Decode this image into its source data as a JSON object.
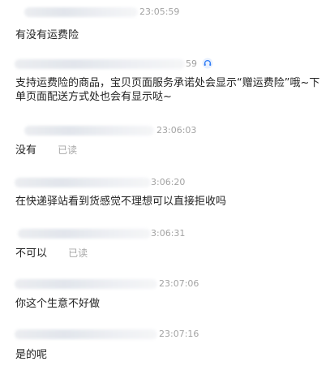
{
  "messages": [
    {
      "time": "23:05:59",
      "text": "有没有运费险"
    },
    {
      "time": "59",
      "text": "支持运费险的商品，宝贝页面服务承诺处会显示“赠运费险”哦~下单页面配送方式处也会有显示哒~",
      "badge_icon": "headset-badge-icon"
    },
    {
      "time": "23:06:03",
      "text": "没有",
      "status": "已读"
    },
    {
      "time": "3:06:20",
      "text": "在快递驿站看到货感觉不理想可以直接拒收吗"
    },
    {
      "time": "3:06:31",
      "text": "不可以",
      "status": "已读"
    },
    {
      "time": "23:07:06",
      "text": "你这个生意不好做"
    },
    {
      "time": "23:07:16",
      "text": "是的呢"
    }
  ],
  "colors": {
    "time": "#a3a3a3",
    "text": "#222222",
    "read": "#a8a8a8",
    "badge": "#2e7cf6"
  }
}
